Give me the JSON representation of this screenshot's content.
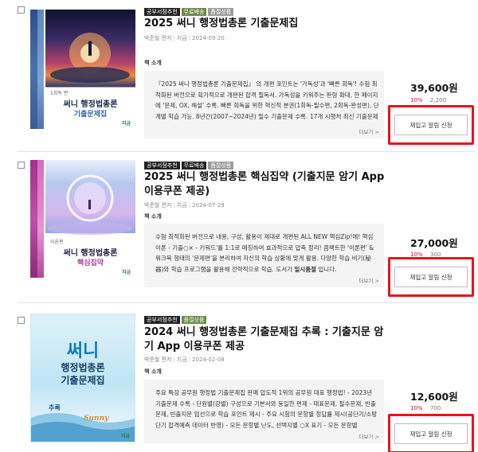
{
  "colors": {
    "highlight": "#e8141c",
    "discount": "#e4002b",
    "badge_dark": "#222222",
    "badge_green": "#6d8b47",
    "badge_grey": "#9c9c9c"
  },
  "items": [
    {
      "badges": [
        "공부서점추천",
        "무료배송",
        "품절상품"
      ],
      "title": "2025 써니 행정법총론 기출문제집",
      "author": "박준철 편저",
      "publisher": "지금",
      "date": "2024-09-20",
      "intro_label": "책 소개",
      "description": "『2025 써니 행정법총론 기출문제집』 의 개편 포인트는 '가독성'과 '빠른 회독'! 수험 최적화된 버전으로 획기적으로 개편된 합격 필독서. 가독성을 키워주는 판형 확대, 한 페이지에 '문제, OX, 해설' 수록. 빠른 회독을 위한 혁신적 분권(1회독-필수편, 2회독-완성편), 단계별 학습 가능. 8년간(2007~2024년) 필수 기출문제 수록. 17개 시행처 최신 기출문제",
      "more": "더보기 >",
      "price": "39,600원",
      "discount": "10%",
      "point": "2,200",
      "restock_label": "재입고 알림 신청",
      "cover": {
        "publisher_mark": "지금",
        "title_line1": "써니 행정법총론",
        "title_line2": "기출문제집",
        "volume": "1회독 편"
      }
    },
    {
      "badges": [
        "공부서점추천",
        "무료배송",
        "품절상품"
      ],
      "title": "2025 써니 행정법총론 핵심집약 (기출지문 암기 App 이용쿠폰 제공)",
      "author": "박준철 편저",
      "publisher": "지금",
      "date": "2024-07-29",
      "intro_label": "책 소개",
      "description_html": "수험 최적화된 버전으로 내용, 구성, 활용이 제대로 개편된 ALL NEW 핵심Zip!에! 핵심 이론 - 기출○× - 키워드'를 1:1로 매칭하여 효과적으로 압축 정리! 콤팩트한 '이론편' & 워크북 형태의 '문제편'을 분리하여 자신의 학습 상황에 맞게 활용. 다양한 학습 비기(秘器)와 학습 프로그램을 활용해 전략적으로 학습. 도서가 <b>일시품절</b> 입니다.",
      "more": "더보기 >",
      "price": "27,000원",
      "discount": "10%",
      "point": "300",
      "restock_label": "재입고 알림 신청",
      "cover": {
        "publisher_mark": "지금",
        "title_line1": "써니 행정법총론",
        "title_line2": "핵심집약",
        "volume": "이론편"
      }
    },
    {
      "badges": [
        "공부서점추천",
        "품절상품"
      ],
      "title": "2024 써니 행정법총론 기출문제집 추록 : 기출지문 암기 App 이용쿠폰 제공",
      "author": "박준철 편저",
      "publisher": "지금",
      "date": "2024-02-08",
      "intro_label": "책 소개",
      "description": "주요 특징 공무원 행정법 기출문제집 판매 압도적 1위의 공무원 대표 행정법! - 2023년 기출문제 수록 - 단원별(강별) 구성으로 기본서와 동일한 편제 - 대표문제, 필수문제, 빈출문제, 빈출지문 엄선으로 학습 포인트 제시 - 주요 시험의 문항별 정답률 제시(공단기/소방단기 합격예측 데이터 반영) - 모든 문항별 난도, 선택지별 ○X 표기 - 모든 문항별",
      "more": "더보기 >",
      "price": "12,600원",
      "discount": "10%",
      "point": "700",
      "restock_label": "재입고 알림 신청",
      "cover": {
        "publisher_mark": "지금",
        "title_line1": "써니",
        "title_line2": "행정법총론",
        "title_line3": "기출문제집",
        "volume": "추록",
        "brand": "Sunny"
      }
    }
  ]
}
